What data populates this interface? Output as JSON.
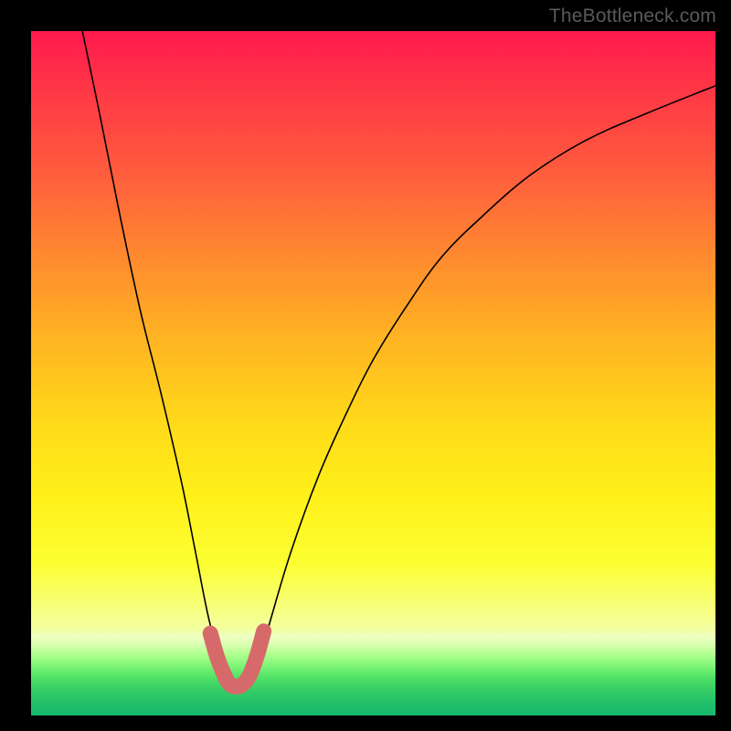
{
  "watermark": "TheBottleneck.com",
  "chart_data": {
    "type": "line",
    "title": "",
    "xlabel": "",
    "ylabel": "",
    "xlim": [
      0,
      100
    ],
    "ylim": [
      0,
      100
    ],
    "series": [
      {
        "name": "curve",
        "x": [
          7.5,
          10,
          13,
          16,
          19,
          22,
          24,
          26,
          28,
          29.3,
          31,
          33,
          35,
          38,
          42,
          46,
          50,
          55,
          60,
          66,
          73,
          81,
          90,
          100
        ],
        "y": [
          100,
          88,
          73,
          59,
          47,
          34,
          24,
          14,
          7,
          4,
          4,
          7,
          14,
          24,
          35,
          44,
          52,
          60,
          67,
          73,
          79,
          84,
          88,
          92
        ]
      },
      {
        "name": "bottom-highlight",
        "x": [
          26.2,
          27.2,
          28.2,
          29.0,
          30.0,
          31.0,
          32.0,
          33.0,
          34.0
        ],
        "y": [
          12.0,
          8.5,
          6.0,
          4.6,
          4.2,
          4.6,
          6.0,
          8.7,
          12.3
        ]
      }
    ],
    "gradient_stops": [
      {
        "pos": 0,
        "color": "#ff1a4d"
      },
      {
        "pos": 50,
        "color": "#ffd400"
      },
      {
        "pos": 88,
        "color": "#f0ffb0"
      },
      {
        "pos": 100,
        "color": "#17b86f"
      }
    ]
  }
}
